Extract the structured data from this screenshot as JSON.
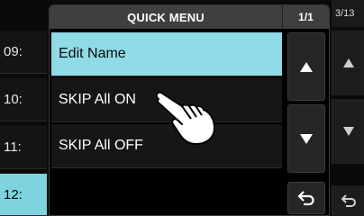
{
  "background": {
    "channels": [
      "09: ",
      "10: ",
      "11: ",
      "12: "
    ],
    "page_indicator": "3/13"
  },
  "dialog": {
    "title": "QUICK MENU",
    "page": "1/1",
    "items": [
      {
        "label": "Edit Name",
        "selected": true
      },
      {
        "label": "SKIP All ON",
        "selected": false
      },
      {
        "label": "SKIP All OFF",
        "selected": false
      }
    ]
  },
  "colors": {
    "selected_row": "#8fdbe6",
    "background_selected_row": "#7fd3de",
    "title_bar": "#3f3f3f"
  },
  "icons": {
    "scroll_up": "triangle-up-icon",
    "scroll_down": "triangle-down-icon",
    "back": "return-arrow-icon",
    "pointer": "hand-pointer-icon"
  }
}
